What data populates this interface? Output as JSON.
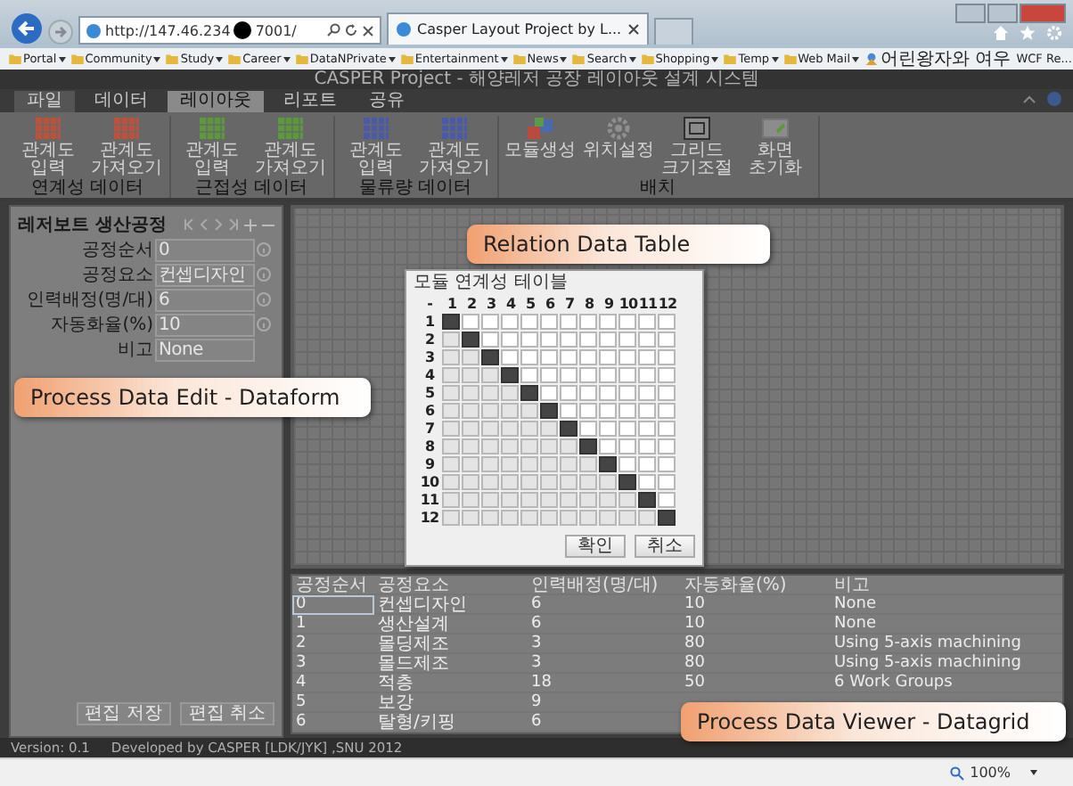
{
  "browser": {
    "address_start": "http://147.46.234",
    "address_end": "7001/",
    "tab_title": "Casper Layout Project by L...",
    "zoom": "100%",
    "favorites": [
      {
        "label": "Portal",
        "kind": "folder",
        "menu": true
      },
      {
        "label": "Community",
        "kind": "folder",
        "menu": true
      },
      {
        "label": "Study",
        "kind": "folder",
        "menu": true
      },
      {
        "label": "Career",
        "kind": "folder",
        "menu": true
      },
      {
        "label": "DataNPrivate",
        "kind": "folder",
        "menu": true
      },
      {
        "label": "Entertainment",
        "kind": "folder",
        "menu": true
      },
      {
        "label": "News",
        "kind": "folder",
        "menu": true
      },
      {
        "label": "Search",
        "kind": "folder",
        "menu": true
      },
      {
        "label": "Shopping",
        "kind": "folder",
        "menu": true
      },
      {
        "label": "Temp",
        "kind": "folder",
        "menu": true
      },
      {
        "label": "Web Mail",
        "kind": "folder",
        "menu": true
      },
      {
        "label": "어린왕자와 여우",
        "kind": "page",
        "menu": false
      },
      {
        "label": "WCF Re...",
        "kind": "plain",
        "menu": false
      }
    ]
  },
  "app": {
    "title": "CASPER Project - 해양레저 공장 레이아웃 설계 시스템",
    "tabs": [
      {
        "label": "파일",
        "kind": "file",
        "selected": false
      },
      {
        "label": "데이터",
        "kind": "tab",
        "selected": false
      },
      {
        "label": "레이아웃",
        "kind": "tab",
        "selected": true
      },
      {
        "label": "리포트",
        "kind": "tab",
        "selected": false
      },
      {
        "label": "공유",
        "kind": "tab",
        "selected": false
      }
    ],
    "ribbon_groups": [
      {
        "label": "연계성 데이터",
        "buttons": [
          {
            "label": "관계도 입력",
            "kind": "grid",
            "color": "#c0503a"
          },
          {
            "label": "관계도 가져오기",
            "kind": "grid",
            "color": "#c0503a"
          }
        ]
      },
      {
        "label": "근접성 데이터",
        "buttons": [
          {
            "label": "관계도 입력",
            "kind": "grid",
            "color": "#5a9a3a"
          },
          {
            "label": "관계도 가져오기",
            "kind": "grid",
            "color": "#5a9a3a"
          }
        ]
      },
      {
        "label": "물류량 데이터",
        "buttons": [
          {
            "label": "관계도 입력",
            "kind": "grid",
            "color": "#4a5aa8"
          },
          {
            "label": "관계도 가져오기",
            "kind": "grid",
            "color": "#4a5aa8"
          }
        ]
      },
      {
        "label": "배치",
        "buttons": [
          {
            "label": "모듈생성",
            "kind": "blocks"
          },
          {
            "label": "위치설정",
            "kind": "gear"
          },
          {
            "label": "그리드 크기조절",
            "kind": "frame"
          },
          {
            "label": "화면 초기화",
            "kind": "reset"
          }
        ]
      }
    ]
  },
  "dataform": {
    "title": "레저보트 생산공정",
    "fields": [
      {
        "label": "공정순서",
        "value": "0",
        "info": true
      },
      {
        "label": "공정요소",
        "value": "컨셉디자인",
        "info": true
      },
      {
        "label": "인력배정(명/대)",
        "value": "6",
        "info": true
      },
      {
        "label": "자동화율(%)",
        "value": "10",
        "info": true
      },
      {
        "label": "비고",
        "value": "None",
        "info": false
      }
    ],
    "buttons": [
      "편집 저장",
      "편집 취소"
    ]
  },
  "dialog": {
    "title": "모듈 연계성 테이블",
    "corner": "-",
    "columns": [
      "1",
      "2",
      "3",
      "4",
      "5",
      "6",
      "7",
      "8",
      "9",
      "10",
      "11",
      "12"
    ],
    "rows": [
      {
        "label": "1",
        "cells": [
          {
            "kind": "diag"
          },
          {
            "kind": "upper"
          },
          {
            "kind": "upper"
          },
          {
            "kind": "upper"
          },
          {
            "kind": "upper"
          },
          {
            "kind": "upper"
          },
          {
            "kind": "upper"
          },
          {
            "kind": "upper"
          },
          {
            "kind": "upper"
          },
          {
            "kind": "upper"
          },
          {
            "kind": "upper"
          },
          {
            "kind": "upper"
          }
        ]
      },
      {
        "label": "2",
        "cells": [
          {
            "kind": "lower"
          },
          {
            "kind": "diag"
          },
          {
            "kind": "upper"
          },
          {
            "kind": "upper"
          },
          {
            "kind": "upper"
          },
          {
            "kind": "upper"
          },
          {
            "kind": "upper"
          },
          {
            "kind": "upper"
          },
          {
            "kind": "upper"
          },
          {
            "kind": "upper"
          },
          {
            "kind": "upper"
          },
          {
            "kind": "upper"
          }
        ]
      },
      {
        "label": "3",
        "cells": [
          {
            "kind": "lower"
          },
          {
            "kind": "lower"
          },
          {
            "kind": "diag"
          },
          {
            "kind": "upper"
          },
          {
            "kind": "upper"
          },
          {
            "kind": "upper"
          },
          {
            "kind": "upper"
          },
          {
            "kind": "upper"
          },
          {
            "kind": "upper"
          },
          {
            "kind": "upper"
          },
          {
            "kind": "upper"
          },
          {
            "kind": "upper"
          }
        ]
      },
      {
        "label": "4",
        "cells": [
          {
            "kind": "lower"
          },
          {
            "kind": "lower"
          },
          {
            "kind": "lower"
          },
          {
            "kind": "diag"
          },
          {
            "kind": "upper"
          },
          {
            "kind": "upper"
          },
          {
            "kind": "upper"
          },
          {
            "kind": "upper"
          },
          {
            "kind": "upper"
          },
          {
            "kind": "upper"
          },
          {
            "kind": "upper"
          },
          {
            "kind": "upper"
          }
        ]
      },
      {
        "label": "5",
        "cells": [
          {
            "kind": "lower"
          },
          {
            "kind": "lower"
          },
          {
            "kind": "lower"
          },
          {
            "kind": "lower"
          },
          {
            "kind": "diag"
          },
          {
            "kind": "upper"
          },
          {
            "kind": "upper"
          },
          {
            "kind": "upper"
          },
          {
            "kind": "upper"
          },
          {
            "kind": "upper"
          },
          {
            "kind": "upper"
          },
          {
            "kind": "upper"
          }
        ]
      },
      {
        "label": "6",
        "cells": [
          {
            "kind": "lower"
          },
          {
            "kind": "lower"
          },
          {
            "kind": "lower"
          },
          {
            "kind": "lower"
          },
          {
            "kind": "lower"
          },
          {
            "kind": "diag"
          },
          {
            "kind": "upper"
          },
          {
            "kind": "upper"
          },
          {
            "kind": "upper"
          },
          {
            "kind": "upper"
          },
          {
            "kind": "upper"
          },
          {
            "kind": "upper"
          }
        ]
      },
      {
        "label": "7",
        "cells": [
          {
            "kind": "lower"
          },
          {
            "kind": "lower"
          },
          {
            "kind": "lower"
          },
          {
            "kind": "lower"
          },
          {
            "kind": "lower"
          },
          {
            "kind": "lower"
          },
          {
            "kind": "diag"
          },
          {
            "kind": "upper"
          },
          {
            "kind": "upper"
          },
          {
            "kind": "upper"
          },
          {
            "kind": "upper"
          },
          {
            "kind": "upper"
          }
        ]
      },
      {
        "label": "8",
        "cells": [
          {
            "kind": "lower"
          },
          {
            "kind": "lower"
          },
          {
            "kind": "lower"
          },
          {
            "kind": "lower"
          },
          {
            "kind": "lower"
          },
          {
            "kind": "lower"
          },
          {
            "kind": "lower"
          },
          {
            "kind": "diag"
          },
          {
            "kind": "upper"
          },
          {
            "kind": "upper"
          },
          {
            "kind": "upper"
          },
          {
            "kind": "upper"
          }
        ]
      },
      {
        "label": "9",
        "cells": [
          {
            "kind": "lower"
          },
          {
            "kind": "lower"
          },
          {
            "kind": "lower"
          },
          {
            "kind": "lower"
          },
          {
            "kind": "lower"
          },
          {
            "kind": "lower"
          },
          {
            "kind": "lower"
          },
          {
            "kind": "lower"
          },
          {
            "kind": "diag"
          },
          {
            "kind": "upper"
          },
          {
            "kind": "upper"
          },
          {
            "kind": "upper"
          }
        ]
      },
      {
        "label": "10",
        "cells": [
          {
            "kind": "lower"
          },
          {
            "kind": "lower"
          },
          {
            "kind": "lower"
          },
          {
            "kind": "lower"
          },
          {
            "kind": "lower"
          },
          {
            "kind": "lower"
          },
          {
            "kind": "lower"
          },
          {
            "kind": "lower"
          },
          {
            "kind": "lower"
          },
          {
            "kind": "diag"
          },
          {
            "kind": "upper"
          },
          {
            "kind": "upper"
          }
        ]
      },
      {
        "label": "11",
        "cells": [
          {
            "kind": "lower"
          },
          {
            "kind": "lower"
          },
          {
            "kind": "lower"
          },
          {
            "kind": "lower"
          },
          {
            "kind": "lower"
          },
          {
            "kind": "lower"
          },
          {
            "kind": "lower"
          },
          {
            "kind": "lower"
          },
          {
            "kind": "lower"
          },
          {
            "kind": "lower"
          },
          {
            "kind": "diag"
          },
          {
            "kind": "upper"
          }
        ]
      },
      {
        "label": "12",
        "cells": [
          {
            "kind": "lower"
          },
          {
            "kind": "lower"
          },
          {
            "kind": "lower"
          },
          {
            "kind": "lower"
          },
          {
            "kind": "lower"
          },
          {
            "kind": "lower"
          },
          {
            "kind": "lower"
          },
          {
            "kind": "lower"
          },
          {
            "kind": "lower"
          },
          {
            "kind": "lower"
          },
          {
            "kind": "lower"
          },
          {
            "kind": "diag"
          }
        ]
      }
    ],
    "buttons": [
      "확인",
      "취소"
    ]
  },
  "datagrid": {
    "columns": [
      "공정순서",
      "공정요소",
      "인력배정(명/대)",
      "자동화율(%)",
      "비고"
    ],
    "rows": [
      {
        "selected": true,
        "cells": [
          "0",
          "컨셉디자인",
          "6",
          "10",
          "None"
        ]
      },
      {
        "selected": false,
        "cells": [
          "1",
          "생산설계",
          "6",
          "10",
          "None"
        ]
      },
      {
        "selected": false,
        "cells": [
          "2",
          "몰딩제조",
          "3",
          "80",
          "Using 5-axis machining"
        ]
      },
      {
        "selected": false,
        "cells": [
          "3",
          "몰드제조",
          "3",
          "80",
          "Using 5-axis machining"
        ]
      },
      {
        "selected": false,
        "cells": [
          "4",
          "적층",
          "18",
          "50",
          "6 Work Groups"
        ]
      },
      {
        "selected": false,
        "cells": [
          "5",
          "보강",
          "9"
        ]
      },
      {
        "selected": false,
        "cells": [
          "6",
          "탈형/키핑",
          "6"
        ]
      }
    ]
  },
  "status": {
    "version": "Version: 0.1",
    "credits": "Developed by CASPER [LDK/JYK] ,SNU 2012"
  },
  "callouts": [
    "Relation Data Table",
    "Process Data Edit - Dataform",
    "Process Data Viewer - Datagrid"
  ]
}
